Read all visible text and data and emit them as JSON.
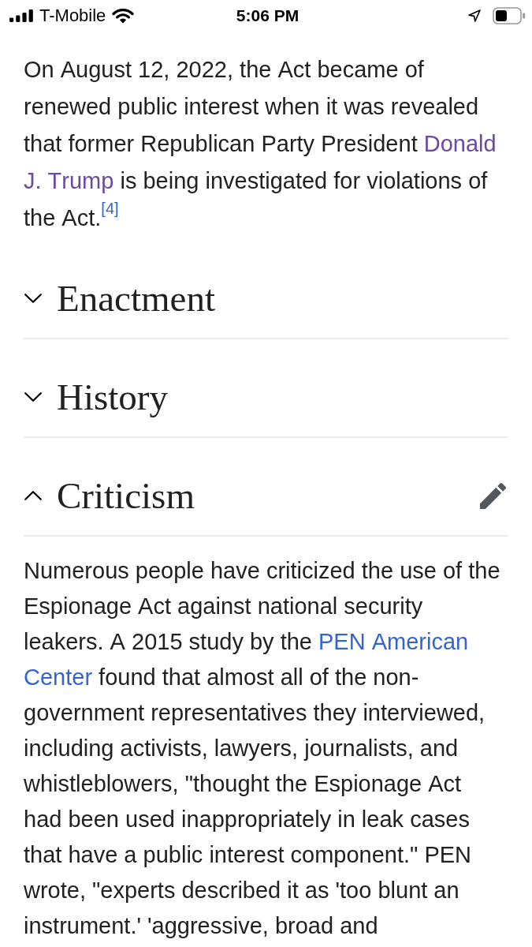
{
  "status_bar": {
    "carrier": "T-Mobile",
    "time": "5:06 PM"
  },
  "intro": {
    "runs": [
      {
        "kind": "text",
        "text": "On August 12, 2022, the Act became of renewed public interest when it was revealed that former Republican Party President "
      },
      {
        "kind": "link",
        "parts": [
          "Donald",
          "J. Trump"
        ],
        "visited": true
      },
      {
        "kind": "text",
        "text": " is being investigated for violations of the Act."
      },
      {
        "kind": "ref",
        "text": "[4]",
        "visited": false
      }
    ]
  },
  "sections": [
    {
      "title": "Enactment",
      "expanded": false
    },
    {
      "title": "History",
      "expanded": false
    },
    {
      "title": "Criticism",
      "expanded": true,
      "runs": [
        {
          "kind": "text",
          "text": "Numerous people have criticized the use of the Espionage Act against national security leakers. A 2015 study by the "
        },
        {
          "kind": "link",
          "parts": [
            "PEN American",
            "Center"
          ],
          "visited": false
        },
        {
          "kind": "text",
          "text": " found that almost all of the non-government representatives they interviewed, including activists, lawyers, journalists, and whistleblowers, \"thought the Espionage Act had been used inappropriately in leak cases that have a public interest component.\" PEN wrote, \"experts described it as 'too blunt an instrument.' 'aggressive, broad and"
        }
      ]
    }
  ]
}
